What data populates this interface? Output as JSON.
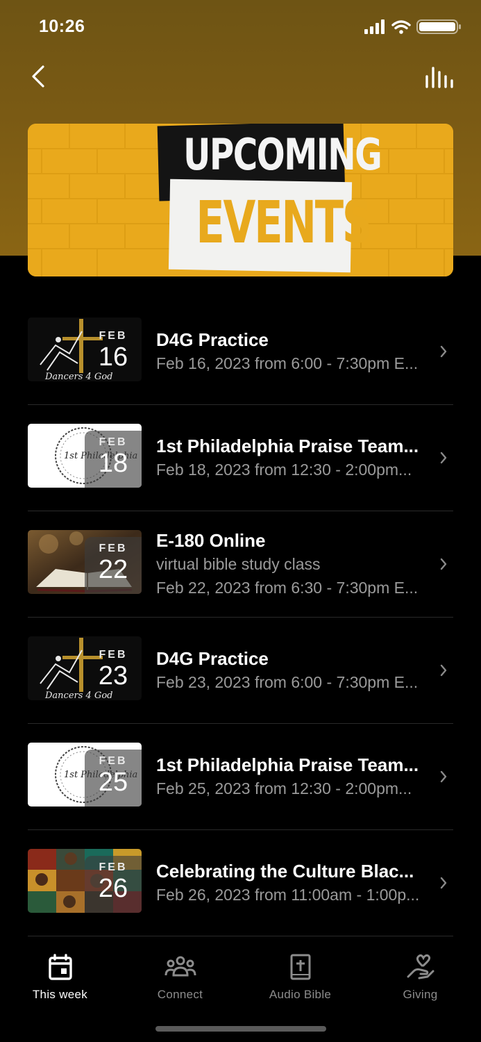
{
  "status_bar": {
    "time": "10:26"
  },
  "banner": {
    "line1": "UPCOMING",
    "line2": "EVENTS"
  },
  "events": [
    {
      "month": "FEB",
      "day": "16",
      "title": "D4G Practice",
      "subtitle": "",
      "when": "Feb 16, 2023 from 6:00 - 7:30pm E...",
      "thumb": "dancers-4-god-logo",
      "thumb_text": "Dancers 4 God"
    },
    {
      "month": "FEB",
      "day": "18",
      "title": "1st Philadelphia Praise Team...",
      "subtitle": "",
      "when": "Feb 18, 2023 from 12:30 - 2:00pm...",
      "thumb": "1st-philadelphia-logo",
      "thumb_text": "1st Philadelphia"
    },
    {
      "month": "FEB",
      "day": "22",
      "title": "E-180 Online",
      "subtitle": "virtual bible study class",
      "when": "Feb 22, 2023 from 6:30 - 7:30pm E...",
      "thumb": "open-bible-photo",
      "thumb_text": ""
    },
    {
      "month": "FEB",
      "day": "23",
      "title": "D4G Practice",
      "subtitle": "",
      "when": "Feb 23, 2023 from 6:00 - 7:30pm E...",
      "thumb": "dancers-4-god-logo",
      "thumb_text": "Dancers 4 God"
    },
    {
      "month": "FEB",
      "day": "25",
      "title": "1st Philadelphia Praise Team...",
      "subtitle": "",
      "when": "Feb 25, 2023 from 12:30 - 2:00pm...",
      "thumb": "1st-philadelphia-logo",
      "thumb_text": "1st Philadelphia"
    },
    {
      "month": "FEB",
      "day": "26",
      "title": "Celebrating the Culture Blac...",
      "subtitle": "",
      "when": "Feb 26, 2023 from 11:00am - 1:00p...",
      "thumb": "portrait-collage",
      "thumb_text": ""
    }
  ],
  "tabs": [
    {
      "label": "This week",
      "icon": "calendar-icon",
      "active": true
    },
    {
      "label": "Connect",
      "icon": "people-icon",
      "active": false
    },
    {
      "label": "Audio Bible",
      "icon": "bible-icon",
      "active": false
    },
    {
      "label": "Giving",
      "icon": "heart-hand-icon",
      "active": false
    }
  ],
  "colors": {
    "accent": "#E8A91D",
    "header": "#7A5A14",
    "background": "#000000",
    "muted": "#9A9A9A"
  }
}
